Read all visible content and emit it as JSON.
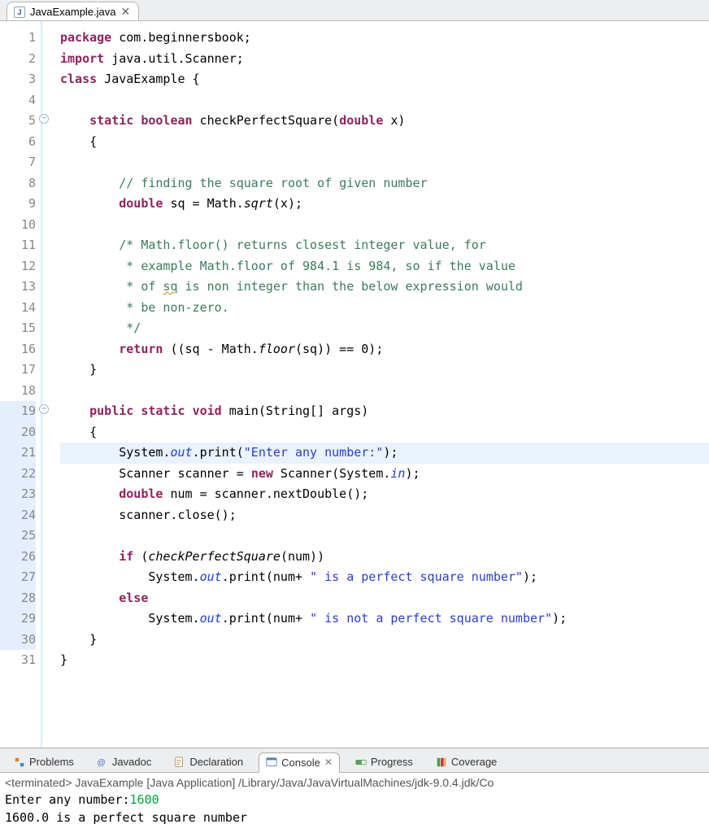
{
  "tab": {
    "filename": "JavaExample.java"
  },
  "code": {
    "lines": [
      [
        {
          "t": "kw",
          "v": "package"
        },
        {
          "t": "plain",
          "v": " com.beginnersbook;"
        }
      ],
      [
        {
          "t": "kw",
          "v": "import"
        },
        {
          "t": "plain",
          "v": " java.util.Scanner;"
        }
      ],
      [
        {
          "t": "kw",
          "v": "class"
        },
        {
          "t": "plain",
          "v": " JavaExample {"
        }
      ],
      [],
      [
        {
          "t": "plain",
          "v": "    "
        },
        {
          "t": "kw",
          "v": "static"
        },
        {
          "t": "plain",
          "v": " "
        },
        {
          "t": "kw",
          "v": "boolean"
        },
        {
          "t": "plain",
          "v": " checkPerfectSquare("
        },
        {
          "t": "kw",
          "v": "double"
        },
        {
          "t": "plain",
          "v": " x)"
        }
      ],
      [
        {
          "t": "plain",
          "v": "    {"
        }
      ],
      [],
      [
        {
          "t": "plain",
          "v": "        "
        },
        {
          "t": "cmt",
          "v": "// finding the square root of given number"
        }
      ],
      [
        {
          "t": "plain",
          "v": "        "
        },
        {
          "t": "kw",
          "v": "double"
        },
        {
          "t": "plain",
          "v": " sq = Math."
        },
        {
          "t": "italic",
          "v": "sqrt"
        },
        {
          "t": "plain",
          "v": "(x);"
        }
      ],
      [],
      [
        {
          "t": "plain",
          "v": "        "
        },
        {
          "t": "cmt",
          "v": "/* Math.floor() returns closest integer value, for"
        }
      ],
      [
        {
          "t": "plain",
          "v": "         "
        },
        {
          "t": "cmt",
          "v": "* example Math.floor of 984.1 is 984, so if the value"
        }
      ],
      [
        {
          "t": "plain",
          "v": "         "
        },
        {
          "t": "cmt",
          "v": "* of "
        },
        {
          "t": "cmt squiggle",
          "v": "sq"
        },
        {
          "t": "cmt",
          "v": " is non integer than the below expression would"
        }
      ],
      [
        {
          "t": "plain",
          "v": "         "
        },
        {
          "t": "cmt",
          "v": "* be non-zero."
        }
      ],
      [
        {
          "t": "plain",
          "v": "         "
        },
        {
          "t": "cmt",
          "v": "*/"
        }
      ],
      [
        {
          "t": "plain",
          "v": "        "
        },
        {
          "t": "kw",
          "v": "return"
        },
        {
          "t": "plain",
          "v": " ((sq - Math."
        },
        {
          "t": "italic",
          "v": "floor"
        },
        {
          "t": "plain",
          "v": "(sq)) == 0);"
        }
      ],
      [
        {
          "t": "plain",
          "v": "    }"
        }
      ],
      [],
      [
        {
          "t": "plain",
          "v": "    "
        },
        {
          "t": "kw",
          "v": "public"
        },
        {
          "t": "plain",
          "v": " "
        },
        {
          "t": "kw",
          "v": "static"
        },
        {
          "t": "plain",
          "v": " "
        },
        {
          "t": "kw",
          "v": "void"
        },
        {
          "t": "plain",
          "v": " main(String[] args)"
        }
      ],
      [
        {
          "t": "plain",
          "v": "    {"
        }
      ],
      [
        {
          "t": "plain",
          "v": "        System."
        },
        {
          "t": "static-ref",
          "v": "out"
        },
        {
          "t": "plain",
          "v": ".print("
        },
        {
          "t": "str",
          "v": "\"Enter any number:\""
        },
        {
          "t": "plain",
          "v": ");"
        }
      ],
      [
        {
          "t": "plain",
          "v": "        Scanner scanner = "
        },
        {
          "t": "kw",
          "v": "new"
        },
        {
          "t": "plain",
          "v": " Scanner(System."
        },
        {
          "t": "static-ref",
          "v": "in"
        },
        {
          "t": "plain",
          "v": ");"
        }
      ],
      [
        {
          "t": "plain",
          "v": "        "
        },
        {
          "t": "kw",
          "v": "double"
        },
        {
          "t": "plain",
          "v": " num = scanner.nextDouble();"
        }
      ],
      [
        {
          "t": "plain",
          "v": "        scanner.close();"
        }
      ],
      [],
      [
        {
          "t": "plain",
          "v": "        "
        },
        {
          "t": "kw",
          "v": "if"
        },
        {
          "t": "plain",
          "v": " ("
        },
        {
          "t": "italic",
          "v": "checkPerfectSquare"
        },
        {
          "t": "plain",
          "v": "(num))"
        }
      ],
      [
        {
          "t": "plain",
          "v": "            System."
        },
        {
          "t": "static-ref",
          "v": "out"
        },
        {
          "t": "plain",
          "v": ".print(num+ "
        },
        {
          "t": "str",
          "v": "\" is a perfect square number\""
        },
        {
          "t": "plain",
          "v": ");"
        }
      ],
      [
        {
          "t": "plain",
          "v": "        "
        },
        {
          "t": "kw",
          "v": "else"
        }
      ],
      [
        {
          "t": "plain",
          "v": "            System."
        },
        {
          "t": "static-ref",
          "v": "out"
        },
        {
          "t": "plain",
          "v": ".print(num+ "
        },
        {
          "t": "str",
          "v": "\" is not a perfect square number\""
        },
        {
          "t": "plain",
          "v": ");"
        }
      ],
      [
        {
          "t": "plain",
          "v": "    }"
        }
      ],
      [
        {
          "t": "plain",
          "v": "}"
        }
      ]
    ],
    "foldLines": [
      5,
      19
    ],
    "highlightLine": 21,
    "changeRange": [
      19,
      30
    ]
  },
  "bottomTabs": [
    {
      "label": "Problems",
      "icon": "problems"
    },
    {
      "label": "Javadoc",
      "icon": "javadoc"
    },
    {
      "label": "Declaration",
      "icon": "declaration"
    },
    {
      "label": "Console",
      "icon": "console",
      "active": true
    },
    {
      "label": "Progress",
      "icon": "progress"
    },
    {
      "label": "Coverage",
      "icon": "coverage"
    }
  ],
  "console": {
    "header": "<terminated> JavaExample [Java Application] /Library/Java/JavaVirtualMachines/jdk-9.0.4.jdk/Co",
    "prompt": "Enter any number:",
    "input": "1600",
    "output": "1600.0 is a perfect square number"
  }
}
